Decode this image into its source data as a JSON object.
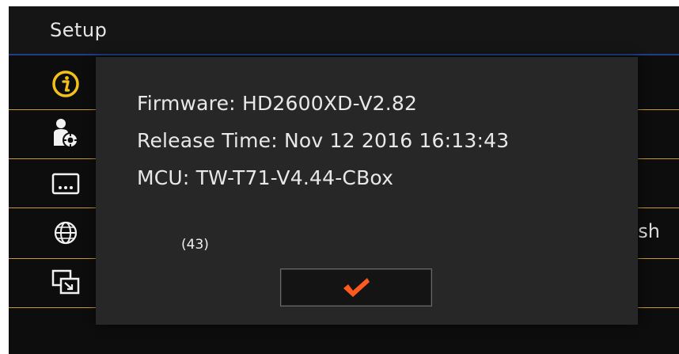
{
  "header": {
    "title": "Setup"
  },
  "menu": {
    "items": [
      {
        "icon": "info-icon",
        "value": ""
      },
      {
        "icon": "user-settings-icon",
        "value": ""
      },
      {
        "icon": "subtitle-icon",
        "value": ""
      },
      {
        "icon": "language-globe-icon",
        "value": "sh"
      },
      {
        "icon": "display-icon",
        "value": ""
      }
    ]
  },
  "dialog": {
    "firmware": "Firmware: HD2600XD-V2.82",
    "release_time": "Release Time: Nov 12 2016 16:13:43",
    "mcu": "MCU: TW-T71-V4.44-CBox",
    "count": "(43)",
    "ok_icon": "checkmark-icon"
  },
  "colors": {
    "accent_line": "#1f3f8c",
    "separator": "#c99a2e",
    "info_icon": "#f2c21a",
    "checkmark": "#ff5a1e"
  }
}
